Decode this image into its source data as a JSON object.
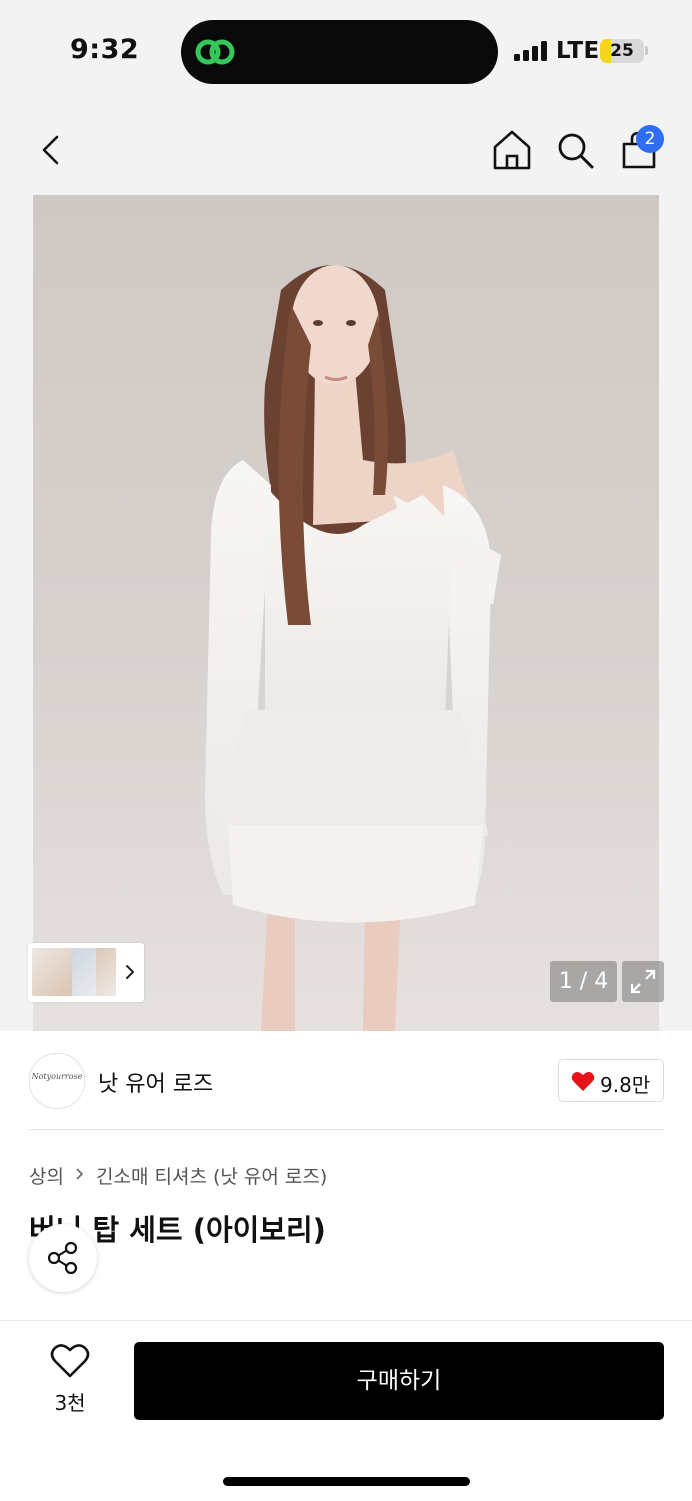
{
  "status_bar": {
    "time": "9:32",
    "network": "LTE",
    "battery_level": "25",
    "battery_fraction": 0.25,
    "battery_color": "#f7d51d",
    "island_icon": "link-icon",
    "island_icon_color": "#34c759"
  },
  "nav": {
    "back_icon": "chevron-left-icon",
    "home_icon": "home-icon",
    "search_icon": "search-icon",
    "cart_icon": "shopping-bag-icon",
    "cart_badge": "2",
    "badge_color": "#2f6ef2"
  },
  "gallery": {
    "page_counter": "1 / 4",
    "expand_icon": "expand-icon",
    "thumb_chevron_icon": "chevron-right-icon"
  },
  "brand": {
    "logo_text": "Notyourrose",
    "name": "낫 유어 로즈",
    "likes": "9.8만",
    "like_icon": "heart-filled-icon",
    "like_color": "#e8121a"
  },
  "breadcrumb": {
    "category": "상의",
    "subcategory": "긴소매 티셔츠 (낫 유어 로즈)"
  },
  "product": {
    "title": "버니 탑 세트 (아이보리)",
    "share_icon": "share-icon"
  },
  "bottom_bar": {
    "wishlist_icon": "heart-outline-icon",
    "wishlist_count": "3천",
    "buy_label": "구매하기"
  }
}
